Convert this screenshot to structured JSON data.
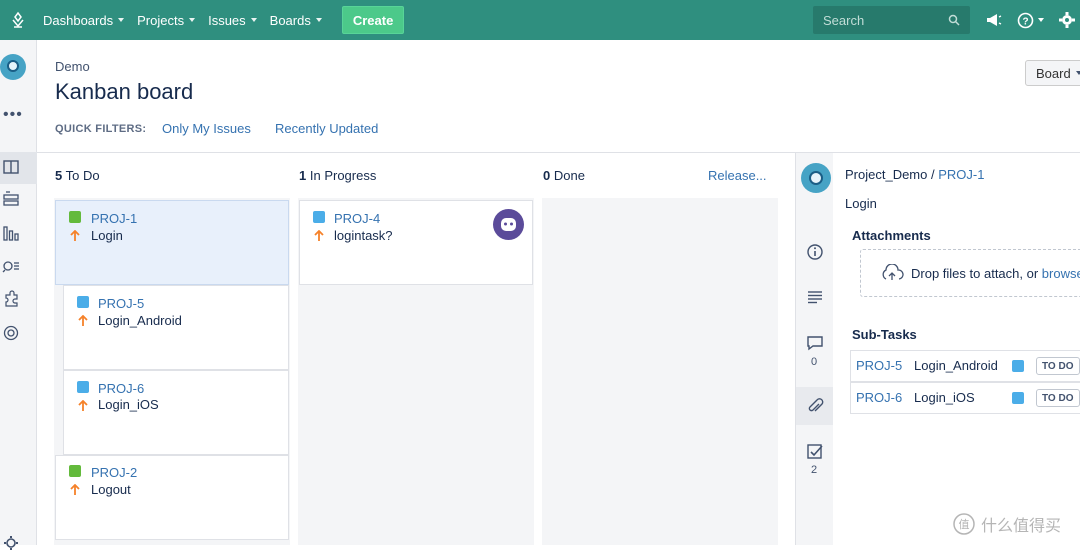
{
  "nav": {
    "items": [
      {
        "label": "Dashboards"
      },
      {
        "label": "Projects"
      },
      {
        "label": "Issues"
      },
      {
        "label": "Boards"
      }
    ],
    "create_label": "Create",
    "search_placeholder": "Search",
    "brand_color": "#2f8f7f",
    "create_color": "#4cc98a"
  },
  "sidebar": {
    "icons": [
      "board-icon",
      "backlog-icon",
      "reports-icon",
      "search-issues-icon",
      "add-ons-icon",
      "settings-icon"
    ]
  },
  "header": {
    "project": "Demo",
    "title": "Kanban board",
    "quick_filters_label": "QUICK FILTERS:",
    "quick_filters": [
      "Only My Issues",
      "Recently Updated"
    ],
    "board_button": "Board"
  },
  "columns": [
    {
      "count": "5",
      "name": "To Do"
    },
    {
      "count": "1",
      "name": "In Progress"
    },
    {
      "count": "0",
      "name": "Done"
    }
  ],
  "release_link": "Release...",
  "cards": {
    "todo": [
      {
        "key": "PROJ-1",
        "summary": "Login",
        "type": "story"
      },
      {
        "key": "PROJ-5",
        "summary": "Login_Android",
        "type": "subtask"
      },
      {
        "key": "PROJ-6",
        "summary": "Login_iOS",
        "type": "subtask"
      },
      {
        "key": "PROJ-2",
        "summary": "Logout",
        "type": "story"
      }
    ],
    "inprogress": [
      {
        "key": "PROJ-4",
        "summary": "logintask?",
        "type": "task"
      }
    ]
  },
  "detail": {
    "project_link": "Project_Demo",
    "separator": "/",
    "issue_key": "PROJ-1",
    "summary": "Login",
    "attachments_title": "Attachments",
    "drop_text": "Drop files to attach, or",
    "browse_link": "browse",
    "subtasks_title": "Sub-Tasks",
    "subtasks": [
      {
        "key": "PROJ-5",
        "summary": "Login_Android",
        "status": "TO DO"
      },
      {
        "key": "PROJ-6",
        "summary": "Login_iOS",
        "status": "TO DO"
      }
    ],
    "comment_count": "0",
    "subtask_count": "2"
  },
  "watermark": "什么值得买"
}
